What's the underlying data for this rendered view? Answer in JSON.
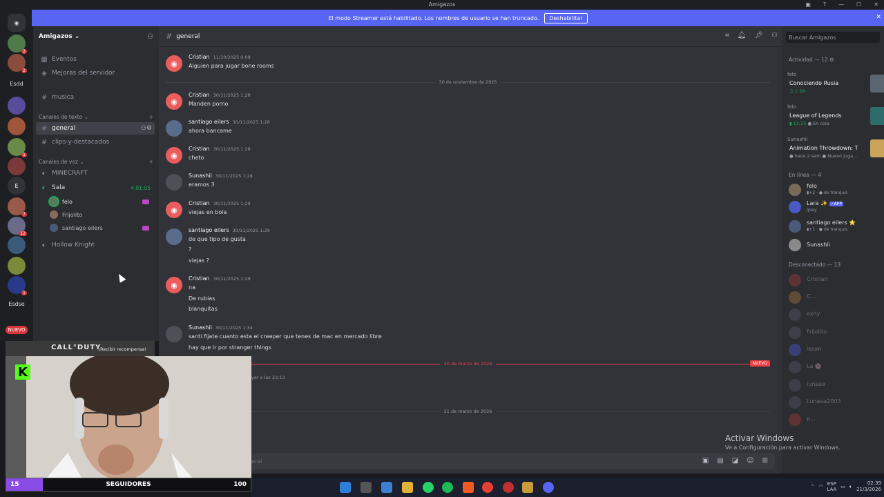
{
  "window": {
    "title": "Amigazos"
  },
  "banner": {
    "text": "El modo Streamer está habilitado. Los nombres de usuario se han truncado.",
    "button": "Deshabilitar"
  },
  "servers": [
    {
      "label": "",
      "badge": "2"
    },
    {
      "label": "",
      "badge": "2"
    },
    {
      "label": "Esdd",
      "badge": ""
    },
    {
      "label": "",
      "badge": ""
    },
    {
      "label": "",
      "badge": ""
    },
    {
      "label": "",
      "badge": "1"
    },
    {
      "label": "",
      "badge": ""
    },
    {
      "label": "E",
      "badge": ""
    },
    {
      "label": "",
      "badge": "7"
    },
    {
      "label": "",
      "badge": "12"
    },
    {
      "label": "",
      "badge": ""
    },
    {
      "label": "",
      "badge": ""
    },
    {
      "label": "",
      "badge": "1"
    },
    {
      "label": "Esdse",
      "badge": ""
    }
  ],
  "servers_nuevo": "NUEVO",
  "guild": {
    "name": "Amigazos ⌄"
  },
  "channels": {
    "eventos": "Eventos",
    "mejoras": "Mejoras del servidor",
    "musica": "musica",
    "text_category": "Canales de texto ⌄",
    "general": "general",
    "clips": "clips-y-destacados",
    "voice_category": "Canales de voz ⌄",
    "minecraft": "MINECRAFT",
    "sala": "Sala",
    "sala_time": "4:01:05",
    "voice_users": [
      "felo",
      "Frijolito",
      "santiago eilers"
    ],
    "hollow": "Hollow Knight"
  },
  "header": {
    "channel": "general",
    "search_placeholder": "Buscar Amigazos"
  },
  "messages": [
    {
      "author": "Cristian",
      "ts": "11/10/2025 0:09",
      "lines": [
        "Alguien para jugar bone rooms"
      ]
    },
    {
      "author": "Cristian",
      "ts": "30/11/2025 1:28",
      "lines": [
        "Manden porno"
      ]
    },
    {
      "author": "santiago eilers",
      "ts": "30/11/2025 1:28",
      "lines": [
        "ahora bancame"
      ]
    },
    {
      "author": "Cristian",
      "ts": "30/11/2025 1:28",
      "lines": [
        "cheto"
      ]
    },
    {
      "author": "Sunashii",
      "ts": "30/11/2025 1:28",
      "lines": [
        "eramos 3"
      ]
    },
    {
      "author": "Cristian",
      "ts": "30/11/2025 1:29",
      "lines": [
        "viejas en bola"
      ]
    },
    {
      "author": "santiago eilers",
      "ts": "30/11/2025 1:29",
      "lines": [
        "de que tipo de gusta",
        "?",
        "viejas ?"
      ]
    },
    {
      "author": "Cristian",
      "ts": "30/11/2025 1:29",
      "lines": [
        "na",
        "De rubias",
        "blanquitas"
      ]
    },
    {
      "author": "Sunashii",
      "ts": "30/11/2025 1:34",
      "lines": [
        "santi fijate cuanto esta el creeper que tenes de mac en mercado libre",
        "hay que ir por stranger things"
      ]
    }
  ],
  "dividers": {
    "d1": "30 de noviembre de 2025",
    "d2": "20 de marzo de 2026",
    "d3": "21 de marzo de 2026",
    "nuevo": "NUEVO"
  },
  "partial_ts": "ayer a las 23:13",
  "composer": {
    "placeholder": "eral"
  },
  "activity": {
    "title": "Actividad — 12 ⚙",
    "items": [
      {
        "who": "felo",
        "what": "Conociendo Rusia",
        "sub": "♫ 1:59",
        "dim": ""
      },
      {
        "who": "felo",
        "what": "League of Legends",
        "sub": "▮ 13:35",
        "dim": "● En cola"
      },
      {
        "who": "Sunashii",
        "what": "Animation Throwdown: Th...",
        "sub": "",
        "dim": "● hace 2 sem  ● Nuevo juga..."
      }
    ]
  },
  "online": {
    "title": "En línea — 4",
    "members": [
      {
        "name": "felo",
        "status": "▮+2 · ● de tranquis"
      },
      {
        "name": "Lara ✨",
        "tag": "✓APP",
        "status": "/play"
      },
      {
        "name": "santiago eilers ⭐",
        "status": "▮+1 · ● de tranquis"
      },
      {
        "name": "Sunashii",
        "status": ""
      }
    ]
  },
  "offline": {
    "title": "Desconectado — 13",
    "members": [
      "Cristian",
      "C...",
      "exhy",
      "Frijolito",
      "lesan",
      "La 🌸",
      "lunaaa",
      "Lunaaa2003",
      "p..."
    ]
  },
  "activate_windows": {
    "line1": "Activar Windows",
    "line2": "Ve a Configuración para activar Windows."
  },
  "overlay": {
    "brand": "CALL°DUTY",
    "reward": "¡Recibir recompensa!",
    "kick": "K",
    "followers": "15",
    "followers_label": "SEGUIDORES",
    "followers_goal": "100",
    "progress": 0.15
  },
  "taskbar": {
    "lang": "ESP",
    "lang2": "LAA",
    "time": "02:39",
    "date": "21/3/2026"
  }
}
